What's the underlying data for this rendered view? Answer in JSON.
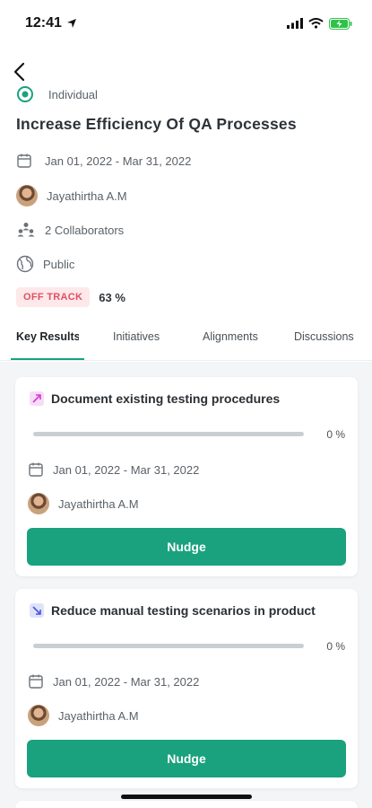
{
  "status": {
    "time": "12:41"
  },
  "objective": {
    "type_label": "Individual",
    "title": "Increase Efficiency Of QA Processes",
    "date_range": "Jan 01, 2022 - Mar 31, 2022",
    "owner": "Jayathirtha A.M",
    "collaborators": "2 Collaborators",
    "visibility": "Public",
    "status_badge": "OFF TRACK",
    "progress": "63 %"
  },
  "tabs": [
    "Key Results",
    "Initiatives",
    "Alignments",
    "Discussions"
  ],
  "key_results": [
    {
      "title": "Document existing testing procedures",
      "progress_label": "0 %",
      "progress_value": 0,
      "date_range": "Jan 01, 2022 - Mar 31, 2022",
      "owner": "Jayathirtha A.M",
      "button": "Nudge",
      "icon_color": "#d63ad6",
      "icon_bg": "#f7dcf7"
    },
    {
      "title": "Reduce manual testing scenarios in product",
      "progress_label": "0 %",
      "progress_value": 0,
      "date_range": "Jan 01, 2022 - Mar 31, 2022",
      "owner": "Jayathirtha A.M",
      "button": "Nudge",
      "icon_color": "#4a56d8",
      "icon_bg": "#dfe2fb"
    }
  ],
  "colors": {
    "accent": "#19a27d",
    "off_track": "#e0505f"
  }
}
